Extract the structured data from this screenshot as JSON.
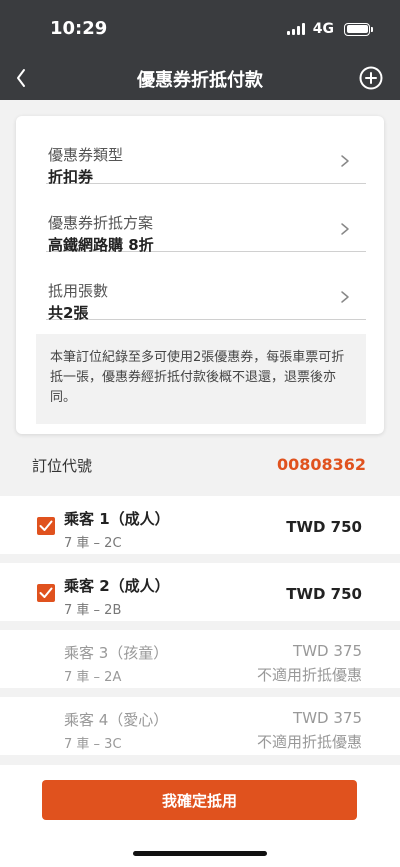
{
  "status": {
    "time": "10:29",
    "network": "4G"
  },
  "nav": {
    "title": "優惠券折抵付款"
  },
  "coupon": {
    "type_label": "優惠券類型",
    "type_value": "折扣券",
    "plan_label": "優惠券折抵方案",
    "plan_value": "高鐵網路購 8折",
    "count_label": "抵用張數",
    "count_value": "共2張",
    "note": "本筆訂位紀錄至多可使用2張優惠券，每張車票可折抵一張，優惠券經折抵付款後概不退還，退票後亦同。"
  },
  "booking": {
    "label": "訂位代號",
    "number": "00808362"
  },
  "passengers": [
    {
      "name": "乘客 1（成人）",
      "seat": "7 車 – 2C",
      "price": "TWD 750",
      "checked": true
    },
    {
      "name": "乘客 2（成人）",
      "seat": "7 車 – 2B",
      "price": "TWD 750",
      "checked": true
    },
    {
      "name": "乘客 3（孩童）",
      "seat": "7 車 – 2A",
      "price": "TWD 375",
      "note": "不適用折抵優惠"
    },
    {
      "name": "乘客 4（愛心）",
      "seat": "7 車 – 3C",
      "price": "TWD 375",
      "note": "不適用折抵優惠"
    }
  ],
  "actions": {
    "confirm_label": "我確定抵用"
  },
  "colors": {
    "accent": "#e0521e",
    "header": "#3a3c3f"
  }
}
